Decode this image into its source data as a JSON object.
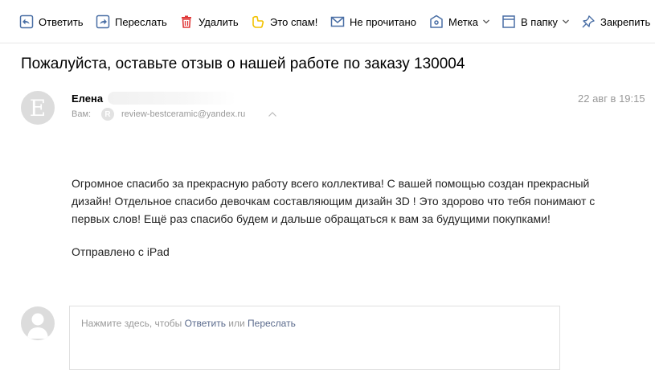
{
  "toolbar": {
    "reply": {
      "label": "Ответить",
      "icon": "reply-icon"
    },
    "forward": {
      "label": "Переслать",
      "icon": "forward-icon"
    },
    "delete": {
      "label": "Удалить",
      "icon": "trash-icon"
    },
    "spam": {
      "label": "Это спам!",
      "icon": "thumb-down-icon"
    },
    "unread": {
      "label": "Не прочитано",
      "icon": "envelope-icon"
    },
    "label": {
      "label": "Метка",
      "icon": "tag-icon"
    },
    "folder": {
      "label": "В папку",
      "icon": "folder-icon"
    },
    "pin": {
      "label": "Закрепить",
      "icon": "pin-icon"
    }
  },
  "message": {
    "subject": "Пожалуйста, оставьте отзыв о нашей работе по заказу 130004",
    "sender": {
      "name": "Елена",
      "avatar_letter": "E"
    },
    "to": {
      "label": "Вам:",
      "badge_letter": "R",
      "email": "review-bestceramic@yandex.ru"
    },
    "date": "22 авг в 19:15",
    "body_lines": [
      "Огромное спасибо за прекрасную работу всего коллектива! С вашей помощью создан прекрасный",
      "дизайн! Отдельное спасибо девочкам составляющим дизайн 3D ! Это здорово что тебя понимают с",
      "первых слов! Ещё раз спасибо будем и дальше обращаться к вам за будущими покупками!"
    ],
    "signature": "Отправлено с iPad"
  },
  "quick_reply": {
    "prefix": "Нажмите здесь, чтобы ",
    "reply_link": "Ответить",
    "middle": " или ",
    "forward_link": "Переслать"
  },
  "colors": {
    "icon_blue": "#4a6fa5",
    "delete_red": "#e03a3a",
    "spam_yellow": "#f2c200",
    "muted_text": "#999999",
    "link": "#5a6a8c"
  }
}
